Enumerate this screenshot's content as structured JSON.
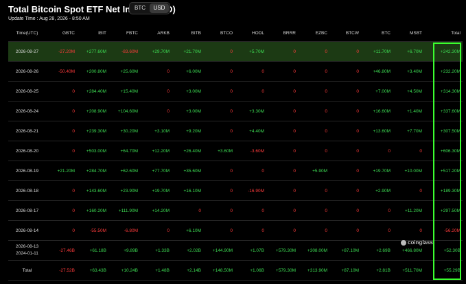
{
  "title": "Total Bitcoin Spot ETF Net Inflow (USD)",
  "update_time": "Update Time : Aug 28, 2026 - 8:50 AM",
  "currency_toggle": {
    "options": [
      "BTC",
      "USD"
    ],
    "selected": "USD"
  },
  "watermark": "coinglass",
  "columns": [
    "Time(UTC)",
    "GBTC",
    "IBIT",
    "FBTC",
    "ARKB",
    "BITB",
    "BTCO",
    "HODL",
    "BRRR",
    "EZBC",
    "BTCW",
    "BTC",
    "MSBT",
    "Total"
  ],
  "rows": [
    [
      "2026-08-27",
      "-27.20M",
      "+277.60M",
      "-83.60M",
      "+29.70M",
      "+21.70M",
      "0",
      "+5.70M",
      "0",
      "0",
      "0",
      "+11.70M",
      "+6.70M",
      "+242.30M"
    ],
    [
      "2026-08-26",
      "-50.40M",
      "+200.80M",
      "+25.60M",
      "0",
      "+6.00M",
      "0",
      "0",
      "0",
      "0",
      "0",
      "+46.80M",
      "+3.40M",
      "+232.20M"
    ],
    [
      "2026-08-25",
      "0",
      "+284.40M",
      "+15.40M",
      "0",
      "+3.00M",
      "0",
      "0",
      "0",
      "0",
      "0",
      "+7.00M",
      "+4.50M",
      "+314.30M"
    ],
    [
      "2026-08-24",
      "0",
      "+208.90M",
      "+104.60M",
      "0",
      "+3.00M",
      "0",
      "+3.30M",
      "0",
      "0",
      "0",
      "+16.60M",
      "+1.40M",
      "+337.60M"
    ],
    [
      "2026-08-21",
      "0",
      "+239.30M",
      "+30.20M",
      "+3.10M",
      "+9.20M",
      "0",
      "+4.40M",
      "0",
      "0",
      "0",
      "+13.60M",
      "+7.70M",
      "+307.50M"
    ],
    [
      "2026-08-20",
      "0",
      "+503.00M",
      "+64.70M",
      "+12.20M",
      "+26.40M",
      "+3.60M",
      "-3.60M",
      "0",
      "0",
      "0",
      "0",
      "0",
      "+606.30M"
    ],
    [
      "2026-08-19",
      "+21.20M",
      "+284.70M",
      "+62.60M",
      "+77.70M",
      "+35.60M",
      "0",
      "0",
      "0",
      "+5.90M",
      "0",
      "+19.70M",
      "+10.00M",
      "+517.20M"
    ],
    [
      "2026-08-18",
      "0",
      "+143.60M",
      "+23.90M",
      "+19.70M",
      "+16.10M",
      "0",
      "-16.90M",
      "0",
      "0",
      "0",
      "+2.90M",
      "0",
      "+189.30M"
    ],
    [
      "2026-08-17",
      "0",
      "+160.20M",
      "+111.90M",
      "+14.20M",
      "0",
      "0",
      "0",
      "0",
      "0",
      "0",
      "0",
      "+11.20M",
      "+297.50M"
    ],
    [
      "2026-08-14",
      "0",
      "-55.50M",
      "-6.80M",
      "0",
      "+6.10M",
      "0",
      "0",
      "0",
      "0",
      "0",
      "0",
      "0",
      "-56.20M"
    ],
    [
      "2026-08-13\n2024-01-11",
      "-27.46B",
      "+61.18B",
      "+9.89B",
      "+1.33B",
      "+2.02B",
      "+144.90M",
      "+1.07B",
      "+579.30M",
      "+308.00M",
      "+87.10M",
      "+2.69B",
      "+466.80M",
      "+52.30B"
    ],
    [
      "Total",
      "-27.52B",
      "+63.43B",
      "+10.24B",
      "+1.48B",
      "+2.14B",
      "+148.50M",
      "+1.06B",
      "+579.30M",
      "+313.90M",
      "+87.10M",
      "+2.81B",
      "+511.70M",
      "+55.29B"
    ]
  ],
  "colors": {
    "positive": "#3ddc53",
    "negative": "#ff3b3b",
    "highlight_row": "#1c3a14",
    "total_box": "#3bff2f"
  }
}
